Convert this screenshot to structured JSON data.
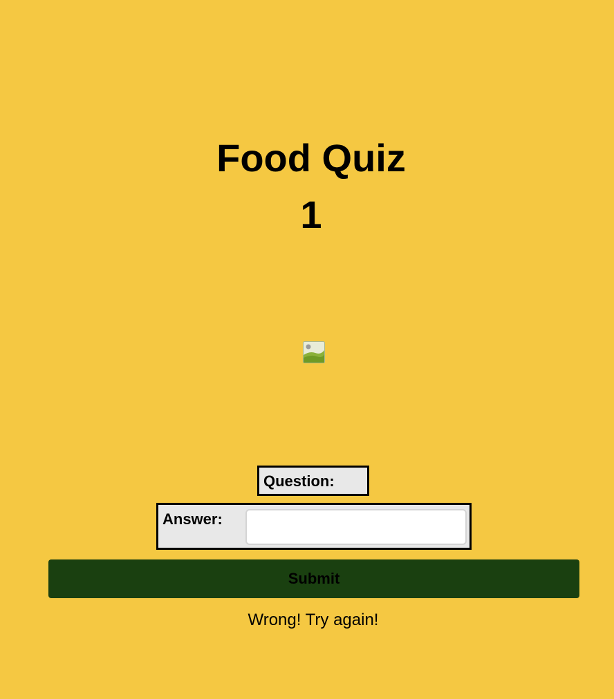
{
  "quiz": {
    "title": "Food Quiz",
    "counter": "1"
  },
  "image": {
    "icon": "broken-image-icon"
  },
  "question": {
    "label": "Question:"
  },
  "answer": {
    "label": "Answer:",
    "value": "",
    "placeholder": ""
  },
  "submit": {
    "label": "Submit"
  },
  "feedback": {
    "message": "Wrong! Try again!"
  },
  "colors": {
    "background": "#f5c842",
    "button": "#1a4010",
    "box": "#e8e8e8"
  }
}
